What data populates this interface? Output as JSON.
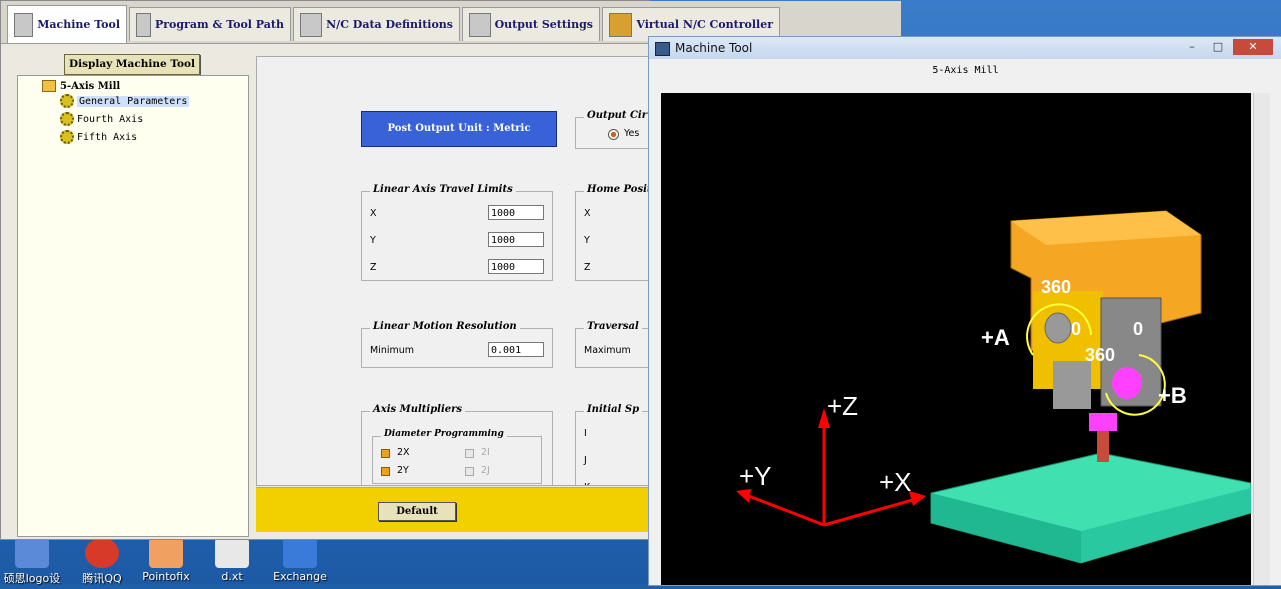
{
  "app": {
    "tabs": [
      {
        "label": "Machine Tool"
      },
      {
        "label": "Program & Tool Path"
      },
      {
        "label": "N/C Data Definitions"
      },
      {
        "label": "Output Settings"
      },
      {
        "label": "Virtual N/C Controller"
      }
    ],
    "display_button": "Display Machine Tool",
    "tree": {
      "root": "5-Axis Mill",
      "items": [
        "General Parameters",
        "Fourth Axis",
        "Fifth Axis"
      ]
    },
    "panel": {
      "unit_button": "Post Output Unit : Metric",
      "output_circ": {
        "title": "Output Cir",
        "radio_label": "Yes"
      },
      "linear_limits": {
        "title": "Linear Axis Travel Limits",
        "rows": [
          {
            "label": "X",
            "value": "1000"
          },
          {
            "label": "Y",
            "value": "1000"
          },
          {
            "label": "Z",
            "value": "1000"
          }
        ]
      },
      "home_position": {
        "title": "Home Positi",
        "labels": [
          "X",
          "Y",
          "Z"
        ]
      },
      "motion_resolution": {
        "title": "Linear Motion Resolution",
        "label": "Minimum",
        "value": "0.001"
      },
      "traversal": {
        "title": "Traversal",
        "label": "Maximum"
      },
      "axis_multipliers": {
        "title": "Axis Multipliers",
        "diameter_title": "Diameter Programming",
        "options": [
          {
            "label": "2X",
            "checked": true
          },
          {
            "label": "2Y",
            "checked": true
          },
          {
            "label": "2I",
            "checked": false
          },
          {
            "label": "2J",
            "checked": false
          }
        ]
      },
      "initial_sp": {
        "title": "Initial Sp",
        "labels": [
          "I",
          "J",
          "K"
        ]
      }
    },
    "default_button": "Default"
  },
  "machine_window": {
    "title": "Machine Tool",
    "header": "5-Axis Mill",
    "buttons": {
      "minimize": "–",
      "maximize": "□",
      "close": "✕"
    },
    "viewport_labels": {
      "a_axis": "+A",
      "b_axis": "+B",
      "z_axis": "+Z",
      "y_axis": "+Y",
      "x_axis": "+X",
      "a_360": "360",
      "a_0": "0",
      "b_0": "0",
      "b_360": "360"
    },
    "colors": {
      "head": "#f5a623",
      "spindle_block": "#f0c000",
      "table": "#40e0b0",
      "tool": "#ff40ff",
      "axes": "#ff0000"
    }
  },
  "desktop": {
    "icons": [
      {
        "label": "硕思logo设"
      },
      {
        "label": "腾讯QQ"
      },
      {
        "label": "Pointofix"
      },
      {
        "label": "d.xt"
      },
      {
        "label": "Exchange"
      }
    ]
  }
}
